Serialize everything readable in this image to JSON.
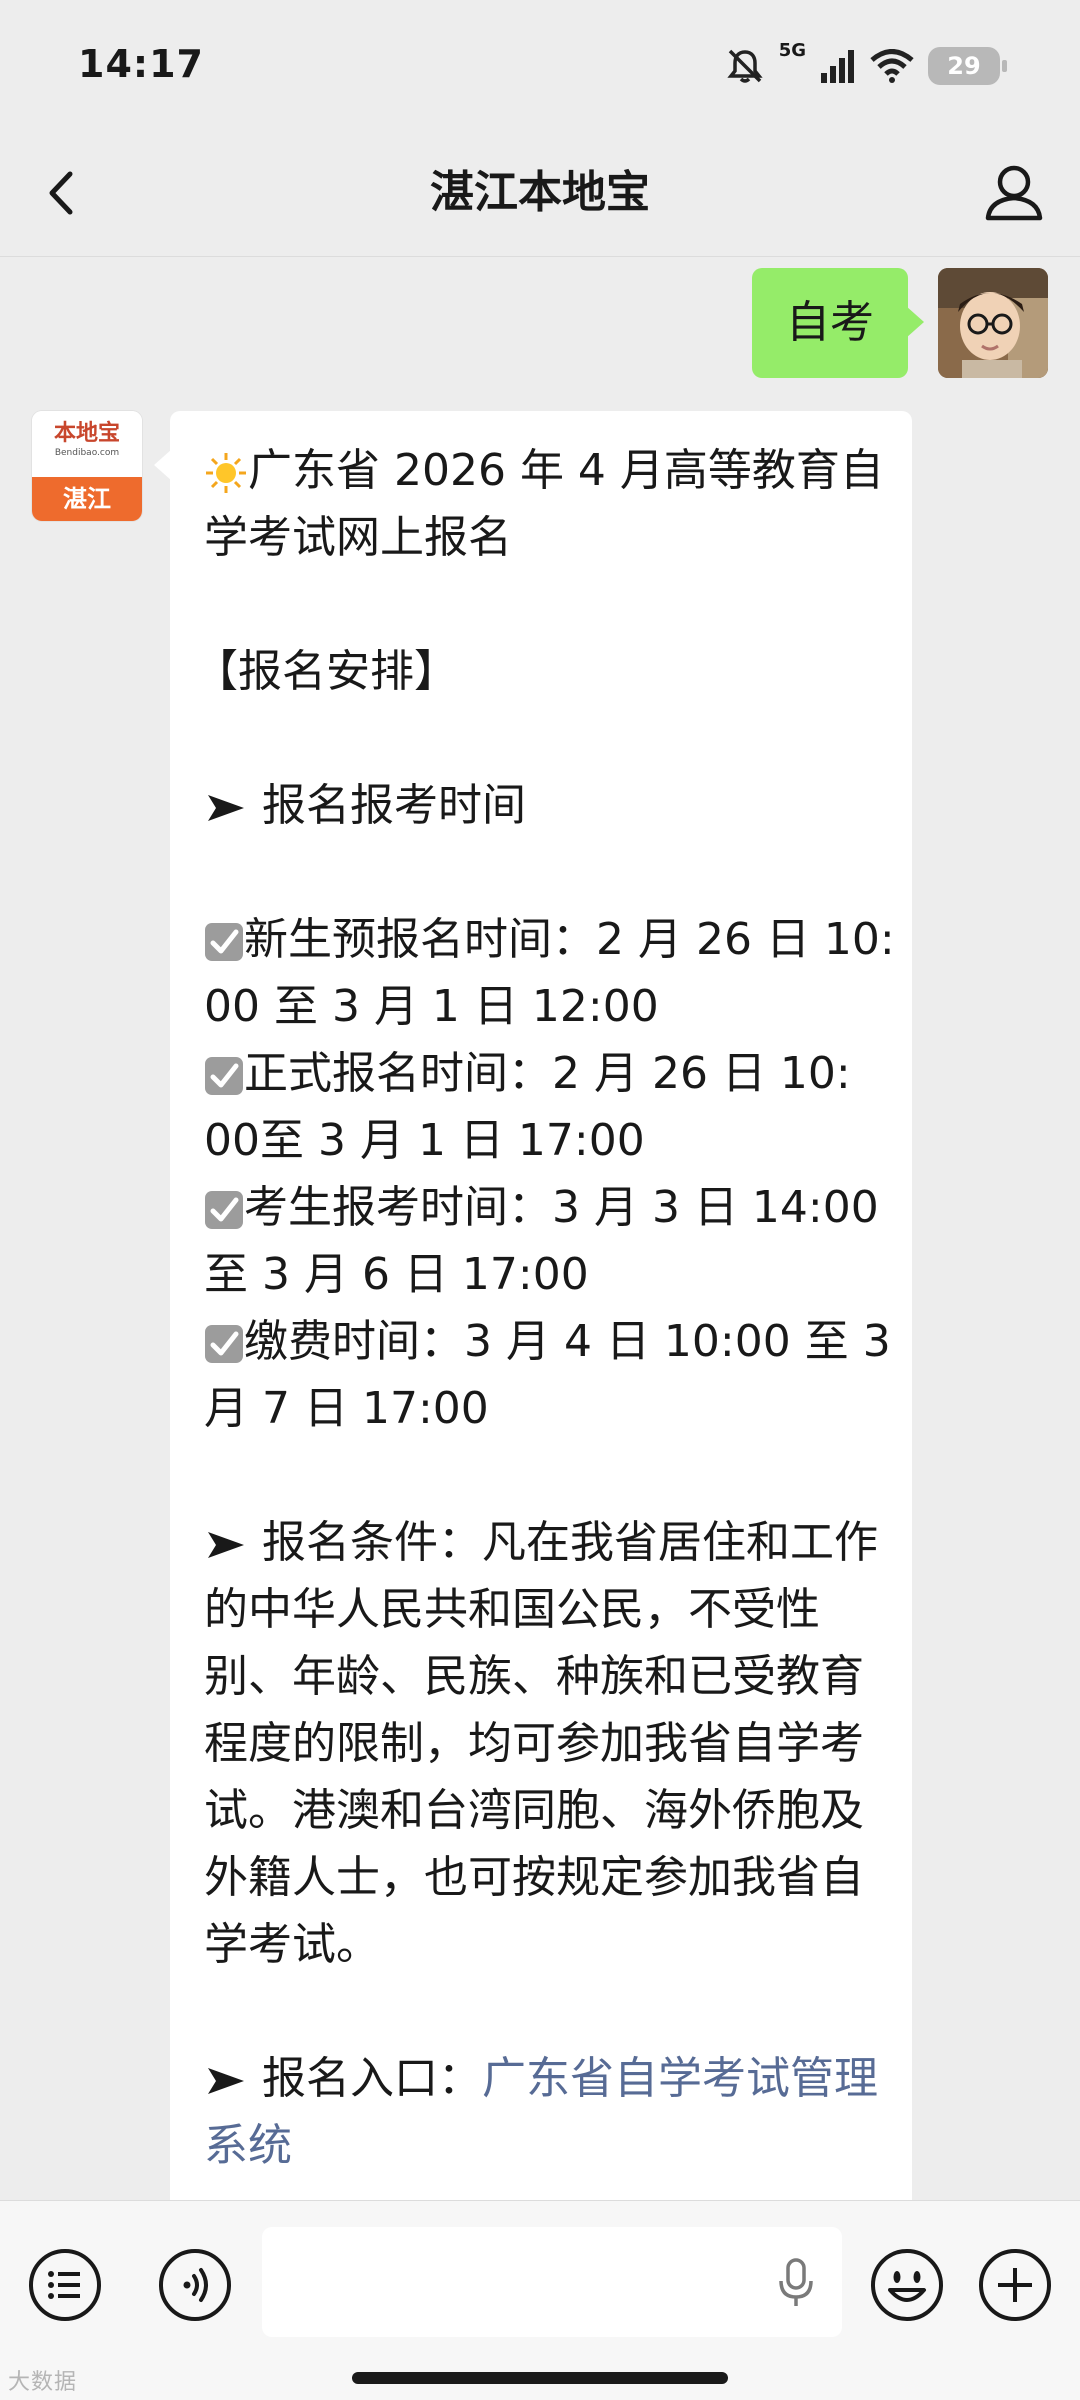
{
  "status_bar": {
    "time": "14:17",
    "network": "5G",
    "battery": "29"
  },
  "nav": {
    "title": "湛江本地宝"
  },
  "user_message": {
    "text": "自考"
  },
  "bot": {
    "avatar_logo_text": "本地宝",
    "avatar_logo_url": "Bendibao.com",
    "avatar_city": "湛江",
    "lines": {
      "l1": "广东省 2026 年 4 月高等教育自",
      "l2": "学考试网上报名",
      "l3": "【报名安排】",
      "l4": "报名报考时间",
      "l5": "新生预报名时间：2 月 26 日 10:",
      "l6": "00 至 3 月 1 日 12:00",
      "l7": "正式报名时间：2 月 26 日 10:",
      "l8": "00至 3 月 1 日 17:00",
      "l9": "考生报考时间：3 月 3 日 14:00",
      "l10": "至 3 月 6 日 17:00",
      "l11": "缴费时间：3 月 4 日 10:00 至 3",
      "l12": "月 7 日 17:00",
      "l13": "报名条件：凡在我省居住和工作",
      "l14": "的中华人民共和国公民，不受性",
      "l15": "别、年龄、民族、种族和已受教育",
      "l16": "程度的限制，均可参加我省自学考",
      "l17": "试。港澳和台湾同胞、海外侨胞及",
      "l18": "外籍人士，也可按规定参加我省自",
      "l19": "学考试。",
      "l20": "报名入口：",
      "l20_link": "广东省自学考试管理",
      "l21_link": "系统"
    }
  },
  "watermark": "大数据",
  "colors": {
    "background": "#ededed",
    "user_bubble": "#95ec69",
    "link": "#576b95",
    "brand_orange": "#ee6b2d"
  },
  "icons": [
    "arrow-left-icon",
    "profile-icon",
    "sun-emoji-icon",
    "check-box-icon",
    "arrow-right-icon",
    "voice-icon",
    "microphone-icon",
    "emoji-icon",
    "plus-icon",
    "menu-list-icon"
  ]
}
